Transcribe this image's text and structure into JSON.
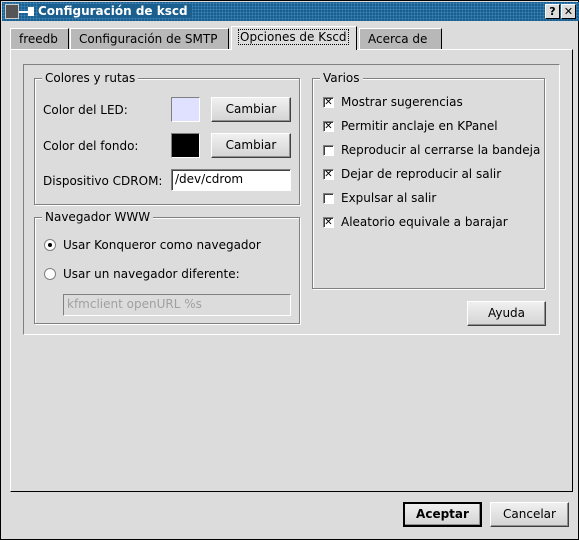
{
  "window": {
    "title": "Configuración de kscd",
    "help_label": "?",
    "close_label": "✕"
  },
  "tabs": [
    {
      "label": "freedb"
    },
    {
      "label": "Configuración de SMTP"
    },
    {
      "label": "Opciones de Kscd",
      "active": true
    },
    {
      "label": "Acerca de"
    }
  ],
  "colors_group": {
    "title": "Colores y rutas",
    "led_label": "Color del LED:",
    "led_color": "#e0e0ff",
    "bg_label": "Color del fondo:",
    "bg_color": "#000000",
    "change_label": "Cambiar",
    "cdrom_label": "Dispositivo CDROM:",
    "cdrom_value": "/dev/cdrom"
  },
  "browser_group": {
    "title": "Navegador WWW",
    "option1": "Usar Konqueror como navegador",
    "option2": "Usar un navegador diferente:",
    "selected": 1,
    "custom_value": "kfmclient openURL %s"
  },
  "misc_group": {
    "title": "Varios",
    "items": [
      {
        "label": "Mostrar sugerencias",
        "checked": true
      },
      {
        "label": "Permitir anclaje en KPanel",
        "checked": true
      },
      {
        "label": "Reproducir al cerrarse la bandeja",
        "checked": false
      },
      {
        "label": "Dejar de reproducir al salir",
        "checked": true
      },
      {
        "label": "Expulsar al salir",
        "checked": false
      },
      {
        "label": "Aleatorio equivale a barajar",
        "checked": true
      }
    ]
  },
  "help_button": "Ayuda",
  "ok_button": "Aceptar",
  "cancel_button": "Cancelar"
}
